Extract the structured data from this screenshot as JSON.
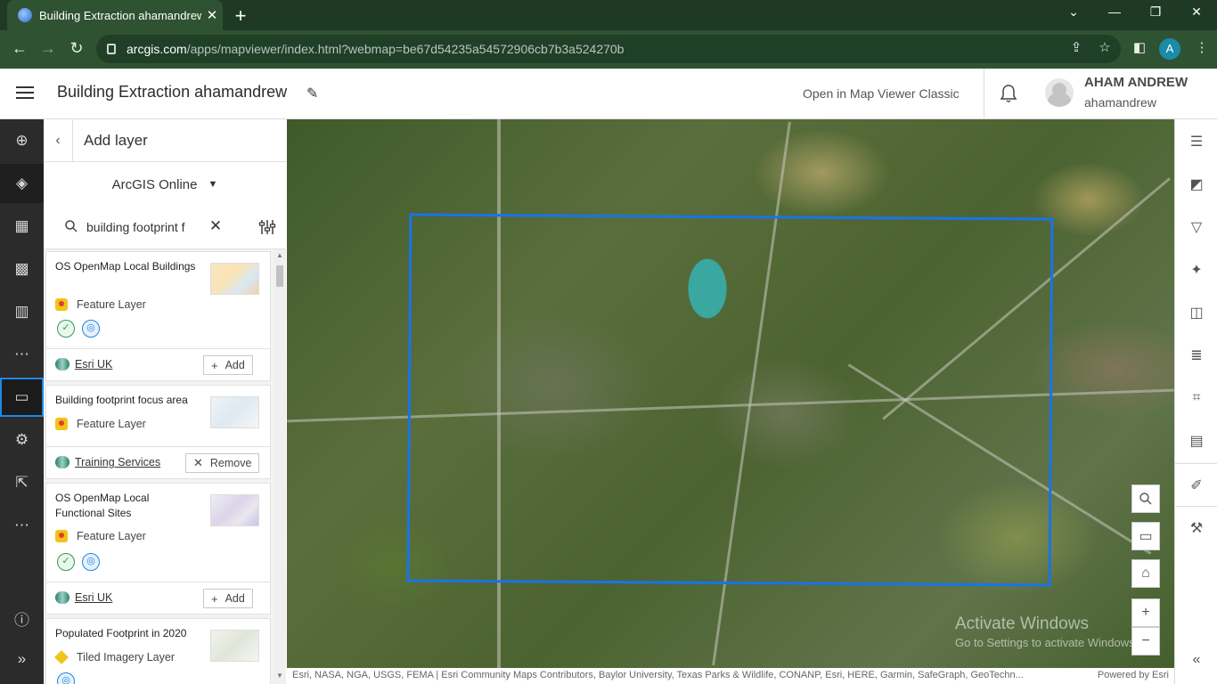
{
  "browser": {
    "tab_title": "Building Extraction ahamandrew",
    "tab_close": "✕",
    "new_tab": "+",
    "url_host": "arcgis.com",
    "url_path": "/apps/mapviewer/index.html?webmap=be67d54235a54572906cb7b3a524270b",
    "profile_initial": "A",
    "win_min": "⌄",
    "win_restore": "—",
    "win_max": "❐",
    "win_close": "✕"
  },
  "header": {
    "map_title": "Building Extraction ahamandrew",
    "open_classic": "Open in Map Viewer Classic",
    "user_name": "AHAM ANDREW",
    "user_login": "ahamandrew"
  },
  "left_toolbar": {
    "icons": [
      "add-icon",
      "layers-icon",
      "table-icon",
      "basemap-icon",
      "charts-icon",
      "more-icon",
      "folder-icon",
      "settings-icon",
      "share-icon",
      "more-icon",
      "info-icon",
      "expand-icon"
    ]
  },
  "panel": {
    "title": "Add layer",
    "source": "ArcGIS Online",
    "search_value": "building footprint f",
    "results": [
      {
        "title": "OS OpenMap Local Buildings",
        "type": "Feature Layer",
        "owner": "Esri UK",
        "action": "Add"
      },
      {
        "title": "Building footprint focus area",
        "type": "Feature Layer",
        "owner": "Training Services",
        "action": "Remove"
      },
      {
        "title": "OS OpenMap Local Functional Sites",
        "type": "Feature Layer",
        "owner": "Esri UK",
        "action": "Add"
      },
      {
        "title": "Populated Footprint in 2020",
        "type": "Tiled Imagery Layer"
      }
    ]
  },
  "map": {
    "watermark_title": "Activate Windows",
    "watermark_sub": "Go to Settings to activate Windows.",
    "attribution": "Esri, NASA, NGA, USGS, FEMA | Esri Community Maps Contributors, Baylor University, Texas Parks & Wildlife, CONANP, Esri, HERE, Garmin, SafeGraph, GeoTechn...",
    "powered_by": "Powered by Esri",
    "extent_color": "#1a73e8"
  },
  "colors": {
    "tabbar": "#1e3a24",
    "chrome": "#2f5233",
    "toolbar_dark": "#2b2b2b",
    "accent": "#1e88e5"
  }
}
